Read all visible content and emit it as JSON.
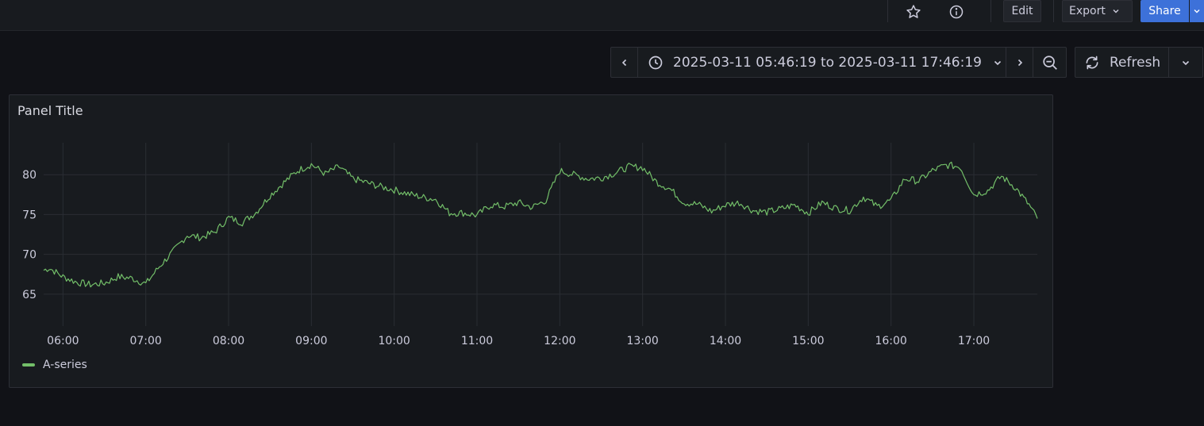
{
  "toolbar": {
    "star_icon": "star-icon",
    "info_icon": "info-icon",
    "edit_label": "Edit",
    "export_label": "Export",
    "share_label": "Share"
  },
  "time_range": {
    "text": "2025-03-11 05:46:19 to 2025-03-11 17:46:19",
    "refresh_label": "Refresh"
  },
  "panel": {
    "title": "Panel Title"
  },
  "colors": {
    "series": "#73bf69",
    "accent": "#3d71d9",
    "background": "#111217",
    "panel": "#181b1f"
  },
  "chart_data": {
    "type": "line",
    "x_ticks": [
      "06:00",
      "07:00",
      "08:00",
      "09:00",
      "10:00",
      "11:00",
      "12:00",
      "13:00",
      "14:00",
      "15:00",
      "16:00",
      "17:00"
    ],
    "y_ticks": [
      65,
      70,
      75,
      80
    ],
    "ylim": [
      63,
      84
    ],
    "xlim": [
      "05:46",
      "17:46"
    ],
    "grid": true,
    "legend_position": "bottom-left",
    "series": [
      {
        "name": "A-series",
        "color": "#73bf69",
        "x": [
          "05:46",
          "05:50",
          "06:00",
          "06:10",
          "06:20",
          "06:30",
          "06:40",
          "06:50",
          "07:00",
          "07:10",
          "07:20",
          "07:30",
          "07:40",
          "07:50",
          "08:00",
          "08:10",
          "08:20",
          "08:30",
          "08:40",
          "08:50",
          "09:00",
          "09:10",
          "09:20",
          "09:30",
          "09:40",
          "09:50",
          "10:00",
          "10:10",
          "10:20",
          "10:30",
          "10:40",
          "10:50",
          "11:00",
          "11:10",
          "11:20",
          "11:30",
          "11:40",
          "11:50",
          "12:00",
          "12:10",
          "12:20",
          "12:30",
          "12:40",
          "12:50",
          "13:00",
          "13:10",
          "13:20",
          "13:30",
          "13:40",
          "13:50",
          "14:00",
          "14:10",
          "14:20",
          "14:30",
          "14:40",
          "14:50",
          "15:00",
          "15:10",
          "15:20",
          "15:30",
          "15:40",
          "15:50",
          "16:00",
          "16:10",
          "16:20",
          "16:30",
          "16:40",
          "16:50",
          "17:00",
          "17:10",
          "17:20",
          "17:30",
          "17:40",
          "17:46"
        ],
        "values": [
          68,
          68.3,
          67.2,
          66.5,
          66.2,
          66.4,
          67.2,
          67,
          66.3,
          68.5,
          70.4,
          72.4,
          72.1,
          72.8,
          74.6,
          74,
          75.3,
          77.4,
          79,
          80.5,
          81.3,
          80.1,
          81,
          79.5,
          79,
          78.5,
          78.1,
          77.6,
          77.2,
          76.9,
          75.2,
          75.2,
          74.9,
          76.2,
          76,
          76.5,
          75.9,
          76.8,
          80.5,
          80,
          79.5,
          79.6,
          80.2,
          81,
          80.9,
          79.1,
          78.2,
          76.5,
          76.3,
          75.4,
          76.2,
          76.5,
          75.5,
          75.3,
          75.7,
          76.2,
          75.2,
          76.5,
          75.8,
          75.5,
          77.2,
          76,
          76.8,
          79.5,
          79.2,
          80.5,
          81.2,
          81,
          77.5,
          78,
          79.8,
          78.4,
          76.2,
          74.5
        ]
      }
    ]
  }
}
